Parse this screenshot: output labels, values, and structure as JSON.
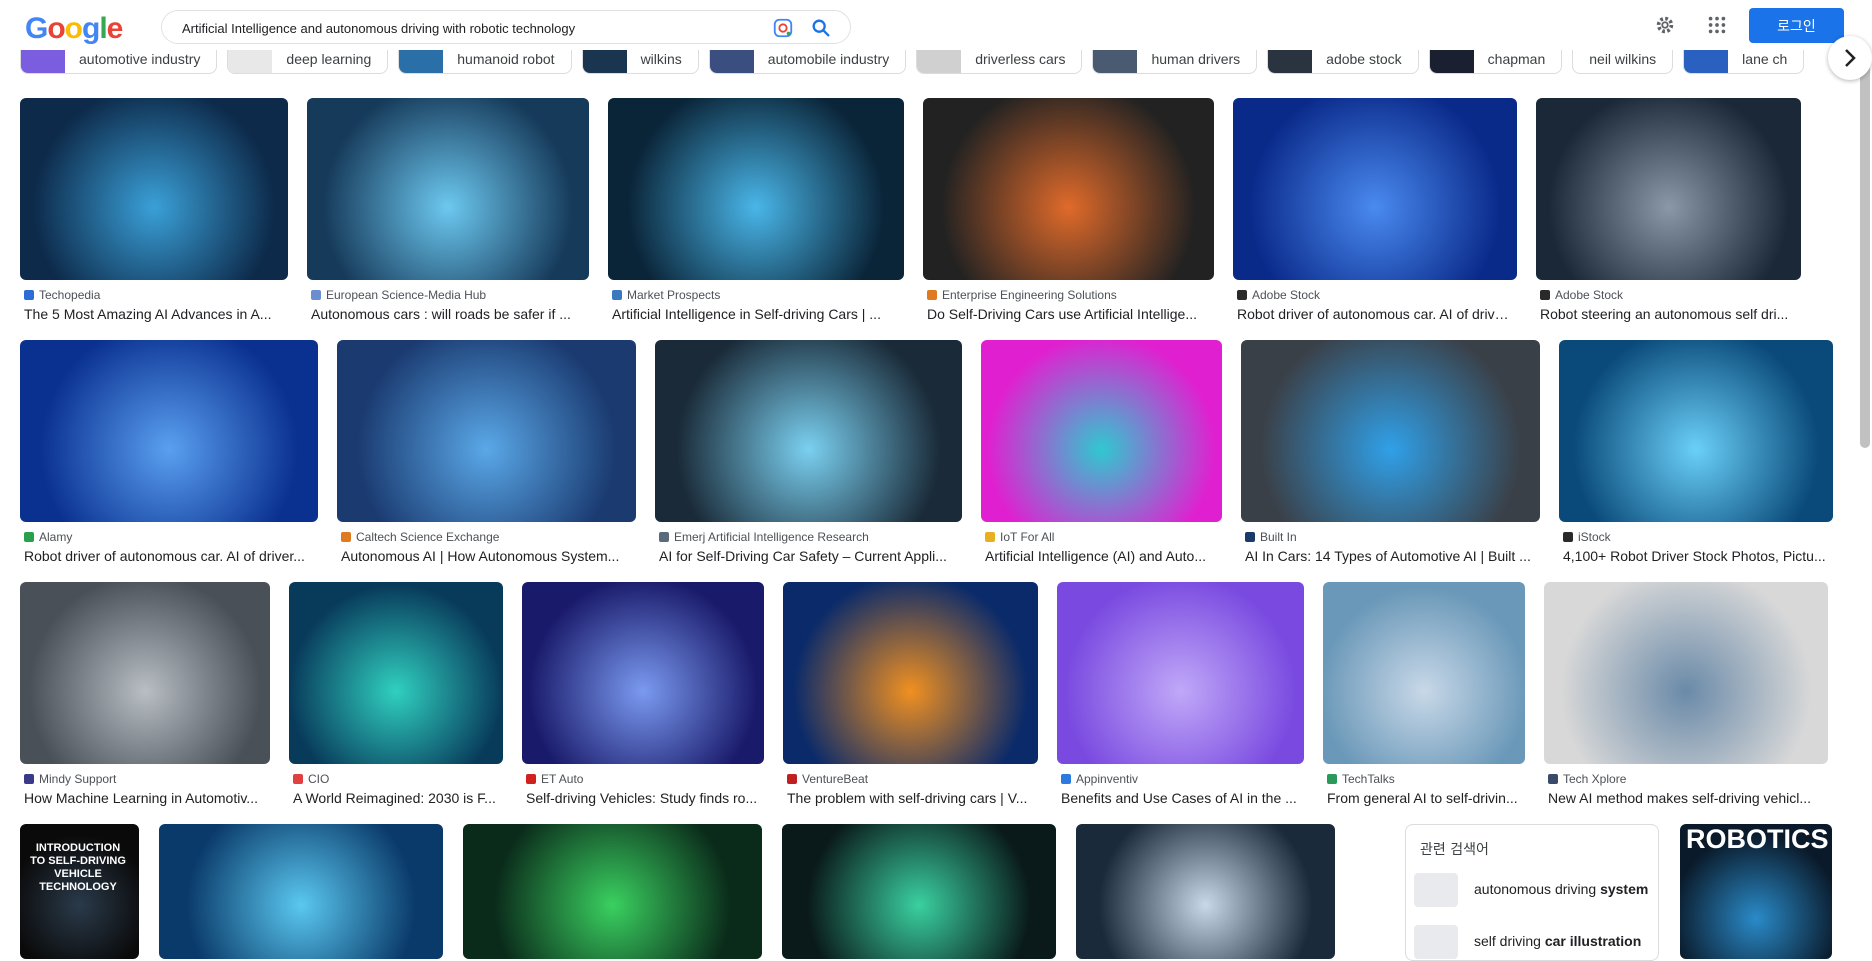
{
  "header": {
    "logo": [
      "G",
      "o",
      "o",
      "g",
      "l",
      "e"
    ],
    "logo_colors": [
      "#4285F4",
      "#EA4335",
      "#FBBC05",
      "#4285F4",
      "#34A853",
      "#EA4335"
    ],
    "search_value": "Artificial Intelligence and autonomous driving with robotic technology",
    "login_label": "로그인",
    "accent": "#1a73e8"
  },
  "chips": [
    {
      "label": "automotive industry",
      "thumb": "#7b5de0"
    },
    {
      "label": "deep learning",
      "thumb": "#e8e8e8"
    },
    {
      "label": "humanoid robot",
      "thumb": "#2a6fa8"
    },
    {
      "label": "wilkins",
      "thumb": "#1a3550"
    },
    {
      "label": "automobile industry",
      "thumb": "#3a4e80"
    },
    {
      "label": "driverless cars",
      "thumb": "#d0d0d0"
    },
    {
      "label": "human drivers",
      "thumb": "#4a5a70"
    },
    {
      "label": "adobe stock",
      "thumb": "#2a3340"
    },
    {
      "label": "chapman",
      "thumb": "#1a2030"
    },
    {
      "label": "neil wilkins",
      "thumb": ""
    },
    {
      "label": "lane ch",
      "thumb": "#2a60c0"
    }
  ],
  "rows": [
    [
      {
        "source": "Techopedia",
        "fav": "#2e6bd6",
        "title": "The 5 Most Amazing AI Advances in A...",
        "w": 268,
        "c1": "#0d2a4a",
        "c2": "#3aa0d8"
      },
      {
        "source": "European Science-Media Hub",
        "fav": "#6a8fd0",
        "title": "Autonomous cars : will roads be safer if ...",
        "w": 282,
        "c1": "#163a5a",
        "c2": "#6cc8f0"
      },
      {
        "source": "Market Prospects",
        "fav": "#3a78c0",
        "title": "Artificial Intelligence in Self-driving Cars | ...",
        "w": 296,
        "c1": "#0a2438",
        "c2": "#49b6e8"
      },
      {
        "source": "Enterprise Engineering Solutions",
        "fav": "#e07a20",
        "title": "Do Self-Driving Cars use Artificial Intellige...",
        "w": 291,
        "c1": "#222",
        "c2": "#e06a2a"
      },
      {
        "source": "Adobe Stock",
        "fav": "#2a2a2a",
        "title": "Robot driver of autonomous car. AI of driverles...",
        "w": 284,
        "c1": "#0a2a8a",
        "c2": "#4a8af0"
      },
      {
        "source": "Adobe Stock",
        "fav": "#2a2a2a",
        "title": "Robot steering an autonomous self dri...",
        "w": 265,
        "c1": "#1a2838",
        "c2": "#8a98a8"
      }
    ],
    [
      {
        "source": "Alamy",
        "fav": "#2aa04a",
        "title": "Robot driver of autonomous car. AI of driver...",
        "w": 298,
        "c1": "#0a3090",
        "c2": "#5aa0f0"
      },
      {
        "source": "Caltech Science Exchange",
        "fav": "#e07a20",
        "title": "Autonomous AI | How Autonomous System...",
        "w": 299,
        "c1": "#1a3a70",
        "c2": "#5aa8e8"
      },
      {
        "source": "Emerj Artificial Intelligence Research",
        "fav": "#5a6a7a",
        "title": "AI for Self-Driving Car Safety – Current Appli...",
        "w": 307,
        "c1": "#1a2a38",
        "c2": "#7ad0f0"
      },
      {
        "source": "IoT For All",
        "fav": "#e8b020",
        "title": "Artificial Intelligence (AI) and Auto...",
        "w": 241,
        "c1": "#e020d0",
        "c2": "#30c8d0"
      },
      {
        "source": "Built In",
        "fav": "#1a3a6a",
        "title": "AI In Cars: 14 Types of Automotive AI | Built ...",
        "w": 299,
        "c1": "#3a4048",
        "c2": "#30a0e8"
      },
      {
        "source": "iStock",
        "fav": "#2a2a2a",
        "title": "4,100+ Robot Driver Stock Photos, Pictu...",
        "w": 274,
        "c1": "#0a4a7a",
        "c2": "#6ad0f8"
      }
    ],
    [
      {
        "source": "Mindy Support",
        "fav": "#3a3a8a",
        "title": "How Machine Learning in Automotiv...",
        "w": 250,
        "c1": "#4a5058",
        "c2": "#b8bec4"
      },
      {
        "source": "CIO",
        "fav": "#e04040",
        "title": "A World Reimagined: 2030 is F...",
        "w": 214,
        "c1": "#083a5a",
        "c2": "#30d0c0"
      },
      {
        "source": "ET Auto",
        "fav": "#d02020",
        "title": "Self-driving Vehicles: Study finds ro...",
        "w": 242,
        "c1": "#1a1a6a",
        "c2": "#7a9af0"
      },
      {
        "source": "VentureBeat",
        "fav": "#c02020",
        "title": "The problem with self-driving cars | V...",
        "w": 255,
        "c1": "#0a2a6a",
        "c2": "#f09020"
      },
      {
        "source": "Appinventiv",
        "fav": "#2a7ae0",
        "title": "Benefits and Use Cases of AI in the ...",
        "w": 247,
        "c1": "#7a4ae0",
        "c2": "#c0a8f8"
      },
      {
        "source": "TechTalks",
        "fav": "#2a9a5a",
        "title": "From general AI to self-drivin...",
        "w": 202,
        "c1": "#6a98b8",
        "c2": "#c8d8e8"
      },
      {
        "source": "Tech Xplore",
        "fav": "#3a4a6a",
        "title": "New AI method makes self-driving vehicl...",
        "w": 284,
        "c1": "#d8d8d8",
        "c2": "#6a8aa8"
      }
    ]
  ],
  "bottom_row": [
    {
      "w": 119,
      "c1": "#0a0a0a",
      "c2": "#2a3a4a",
      "cover_title": "INTRODUCTION TO SELF-DRIVING VEHICLE TECHNOLOGY"
    },
    {
      "w": 284,
      "c1": "#0a3a6a",
      "c2": "#5ac8f0"
    },
    {
      "w": 299,
      "c1": "#0a2a1a",
      "c2": "#3ad060"
    },
    {
      "w": 274,
      "c1": "#0a1a1a",
      "c2": "#3ad0a0"
    },
    {
      "w": 259,
      "c1": "#1a2a3a",
      "c2": "#c8d8e8"
    }
  ],
  "related": {
    "heading": "관련 검색어",
    "items": [
      {
        "text_plain": "autonomous driving ",
        "text_bold": "system"
      },
      {
        "text_plain": "self driving ",
        "text_bold": "car illustration"
      }
    ]
  },
  "right_book": {
    "title": "ROBOTICS",
    "c1": "#0a1a2a",
    "c2": "#2a8ac8"
  }
}
